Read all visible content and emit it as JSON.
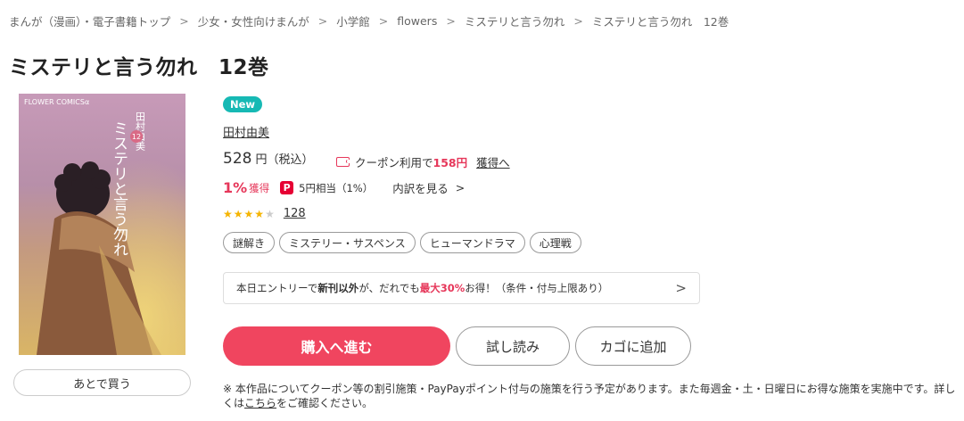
{
  "breadcrumb": [
    "まんが（漫画）・電子書籍トップ",
    "少女・女性向けまんが",
    "小学館",
    "flowers",
    "ミステリと言う勿れ",
    "ミステリと言う勿れ　12巻"
  ],
  "breadcrumb_separator": ">",
  "title": "ミステリと言う勿れ　12巻",
  "cover": {
    "label": "FLOWER COMICSα",
    "title_vertical": "ミステリと言う勿れ",
    "author_vertical": "田村由美",
    "volume": "12"
  },
  "later_button": "あとで買う",
  "badge": "New",
  "author": "田村由美",
  "price": {
    "value": "528",
    "unit": "円（税込）"
  },
  "coupon": {
    "text": "クーポン利用で",
    "amount": "158円",
    "link": "獲得へ"
  },
  "points": {
    "percent": "1%",
    "earn": "獲得",
    "paypay_icon": "P",
    "equivalent": "5円相当（1%）",
    "detail_link": "内訳を見る",
    "chevron": ">"
  },
  "rating": {
    "value": 4.5,
    "count": "128"
  },
  "tags": [
    "謎解き",
    "ミステリー・サスペンス",
    "ヒューマンドラマ",
    "心理戦"
  ],
  "campaign": {
    "pre": "本日エントリーで",
    "bold": "新刊以外",
    "mid": "が、だれでも",
    "red": "最大30%",
    "post": "お得！（条件・付与上限あり）",
    "chevron": ">"
  },
  "buttons": {
    "buy": "購入へ進む",
    "trial": "試し読み",
    "cart": "カゴに追加"
  },
  "note": {
    "pre": "※ 本作品についてクーポン等の割引施策・PayPayポイント付与の施策を行う予定があります。また毎週金・土・日曜日にお得な施策を実施中です。詳しくは",
    "link": "こちら",
    "post": "をご確認ください。"
  },
  "colors": {
    "accent": "#f0455f",
    "price_red": "#e6375a",
    "badge": "#16b9b4",
    "star": "#f5b400"
  }
}
